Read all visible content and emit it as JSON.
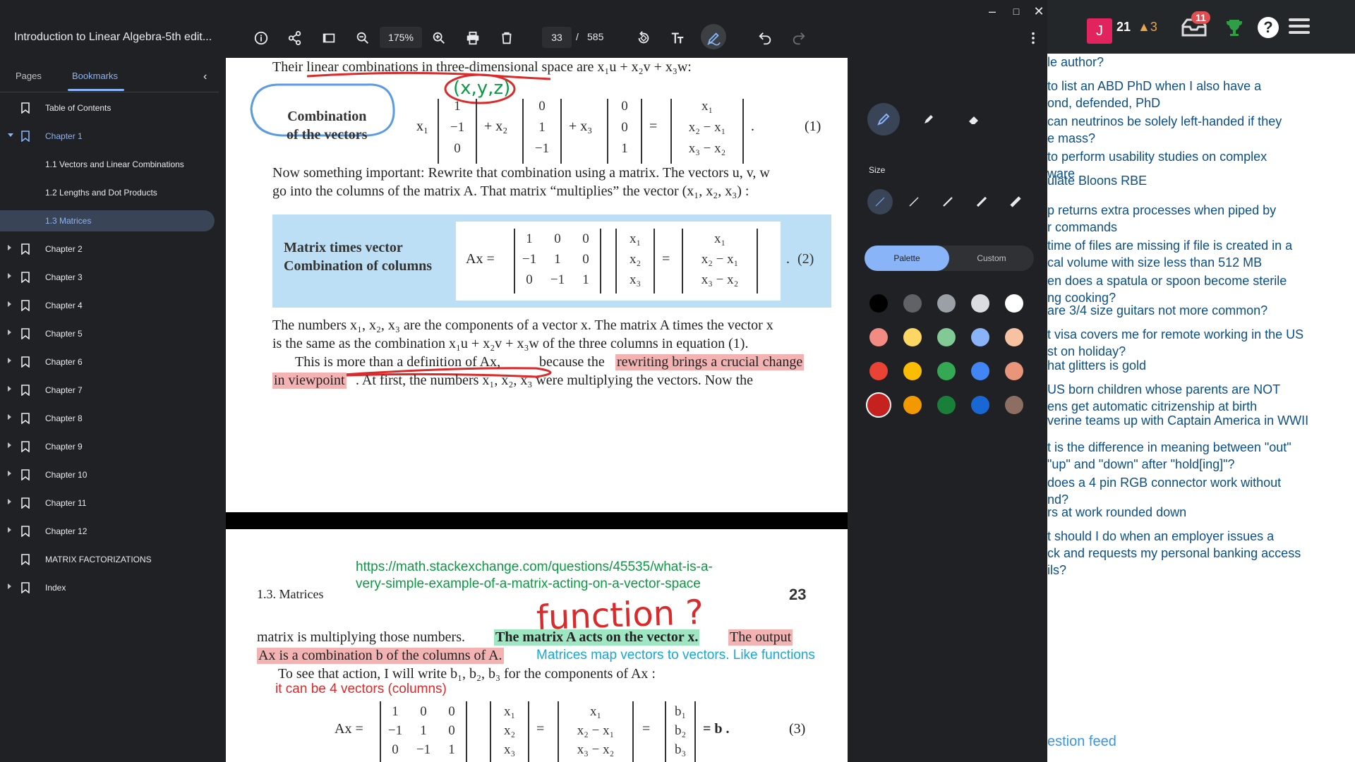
{
  "window": {
    "minimize": "–",
    "maximize": "□",
    "close": "✕"
  },
  "toolbar": {
    "doc_title": "Introduction to Linear Algebra-5th edit...",
    "zoom": "175%",
    "current_page": "33",
    "page_sep": "/",
    "total_pages": "585"
  },
  "sidebar": {
    "tabs": {
      "pages": "Pages",
      "bookmarks": "Bookmarks"
    },
    "collapse": "‹",
    "items": [
      {
        "label": "Table of Contents"
      },
      {
        "label": "Chapter 1"
      },
      {
        "label": "1.1 Vectors and Linear Combinations"
      },
      {
        "label": "1.2 Lengths and Dot Products"
      },
      {
        "label": "1.3 Matrices"
      },
      {
        "label": "Chapter 2"
      },
      {
        "label": "Chapter 3"
      },
      {
        "label": "Chapter 4"
      },
      {
        "label": "Chapter 5"
      },
      {
        "label": "Chapter 6"
      },
      {
        "label": "Chapter 7"
      },
      {
        "label": "Chapter 8"
      },
      {
        "label": "Chapter 9"
      },
      {
        "label": "Chapter 10"
      },
      {
        "label": "Chapter 11"
      },
      {
        "label": "Chapter 12"
      },
      {
        "label": "MATRIX FACTORIZATIONS"
      },
      {
        "label": "Index"
      }
    ]
  },
  "page1": {
    "line1": "Their linear combinations in three-dimensional space are x₁u + x₂v + x₃w:",
    "hand_xyz": "(x,y,z)",
    "combo_box": "Combination\nof the vectors",
    "eq1_x1": "x₁",
    "eq1_plus_x2": "+ x₂",
    "eq1_plus_x3": "+ x₃",
    "eq_equals": "=",
    "eq1_num": "(1)",
    "eq1_dot": ".",
    "eq1_col1": [
      "1",
      "−1",
      "0"
    ],
    "eq1_col2": [
      "0",
      "1",
      "−1"
    ],
    "eq1_col3": [
      "0",
      "0",
      "1"
    ],
    "eq1_res": [
      "x₁",
      "x₂ − x₁",
      "x₃ − x₂"
    ],
    "para1a": "Now something important: Rewrite that combination using a matrix. The vectors u, v, w",
    "para1b": "go into the columns of the matrix A. That matrix “multiplies” the vector (x₁, x₂, x₃) :",
    "box_title1": "Matrix times vector",
    "box_title2": "Combination of columns",
    "eq2_lhs": "Ax =",
    "eq2_A": [
      [
        "1",
        "0",
        "0"
      ],
      [
        "−1",
        "1",
        "0"
      ],
      [
        "0",
        "−1",
        "1"
      ]
    ],
    "eq2_x": [
      "x₁",
      "x₂",
      "x₃"
    ],
    "eq2_res": [
      "x₁",
      "x₂ − x₁",
      "x₃ − x₂"
    ],
    "eq2_num": "(2)",
    "eq2_dot": ".",
    "para2a": "The numbers x₁, x₂, x₃ are the components of a vector x. The matrix A times the vector x",
    "para2b": "is the same as the combination x₁u + x₂v + x₃w of the three columns in equation (1).",
    "para3a_1": "This is more than a definition of Ax,",
    "para3a_2": "because the",
    "para3a_hl": "rewriting brings a crucial change",
    "para3b_hl": "in viewpoint",
    "para3b_rest": ". At first, the numbers x₁, x₂, x₃ were multiplying the vectors. Now the"
  },
  "page2": {
    "header_section": "1.3.  Matrices",
    "header_page": "23",
    "hand_url": "https://math.stackexchange.com/questions/45535/what-is-a-\nvery-simple-example-of-a-matrix-acting-on-a-vector-space",
    "hand_function": "function ?",
    "line1_a": "matrix is multiplying those numbers.",
    "line1_green": "The matrix A acts on the vector x.",
    "line1_red": "The output",
    "line2_red": "Ax is a combination b of the columns of A.",
    "line2_hand": "Matrices map vectors to vectors. Like functions",
    "line3": "To see that action, I will write b₁, b₂, b₃ for the components of Ax :",
    "line4_hand": "it can be 4 vectors (columns)",
    "eq3_lhs": "Ax =",
    "eq3_A": [
      [
        "1",
        "0",
        "0"
      ],
      [
        "−1",
        "1",
        "0"
      ],
      [
        "0",
        "−1",
        "1"
      ]
    ],
    "eq3_x": [
      "x₁",
      "x₂",
      "x₃"
    ],
    "eq3_mid": [
      "x₁",
      "x₂ − x₁",
      "x₃ − x₂"
    ],
    "eq3_b": [
      "b₁",
      "b₂",
      "b₃"
    ],
    "eq3_eq": "=",
    "eq3_end": "= b .",
    "eq3_num": "(3)"
  },
  "pen_panel": {
    "size_label": "Size",
    "palette": "Palette",
    "custom": "Custom",
    "colors": [
      [
        "#000000",
        "#5f6368",
        "#9aa0a6",
        "#dadce0",
        "#ffffff"
      ],
      [
        "#f28b82",
        "#fdd663",
        "#81c995",
        "#8ab4f8",
        "#f6c2a2"
      ],
      [
        "#ea4335",
        "#fbbc04",
        "#34a853",
        "#4285f4",
        "#e8957a"
      ],
      [
        "#c5221f",
        "#f29900",
        "#188038",
        "#1967d2",
        "#8d6e63"
      ]
    ]
  },
  "background_se": {
    "rep": "21",
    "bronze": "▲3",
    "inbox_count": "11",
    "help": "?",
    "questions": [
      "le author?",
      " to list an ABD PhD when I also have a\nond, defended, PhD",
      " can neutrinos be solely left-handed if they\ne mass?",
      " to perform usability studies on complex\nware",
      "ulate Bloons RBE",
      "p returns extra processes when piped by\nr commands",
      " time of files are missing if file is created in a\ncal volume with size less than 512 MB",
      "en does a spatula or spoon become sterile\nng cooking?",
      " are 3/4 size guitars not more common?",
      "t visa covers me for remote working in the US\nst on holiday?",
      "hat glitters is gold",
      "US born children whose parents are NOT\nens get automatic citrizenship at birth",
      "verine teams up with Captain America in WWII",
      "t is the difference in meaning between \"out\"\n\"up\" and \"down\" after \"hold[ing]\"?",
      " does a 4 pin RGB connector work without\nnd?",
      "rs at work rounded down",
      "t should I do when an employer issues a\nck and requests my personal banking access\nils?"
    ],
    "more": "estion feed"
  }
}
